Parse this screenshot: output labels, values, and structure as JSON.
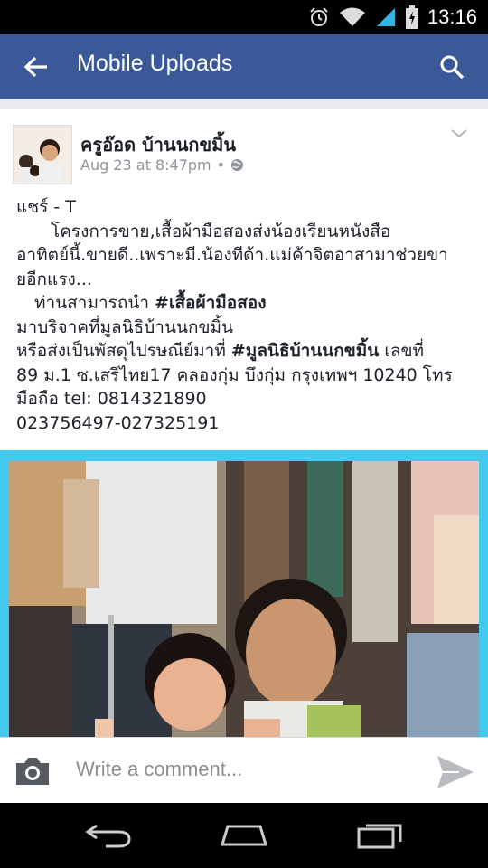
{
  "status_bar": {
    "time": "13:16",
    "icons": [
      "alarm-icon",
      "wifi-icon",
      "signal-icon",
      "battery-icon"
    ]
  },
  "app_bar": {
    "title": "Mobile Uploads",
    "color": "#3b5998",
    "icons": [
      "back-arrow-icon",
      "search-icon"
    ]
  },
  "post": {
    "author": "ครูอ๊อด บ้านนกขมิ้น",
    "timestamp": "Aug 23 at 8:47pm",
    "separator": "•",
    "privacy_icon": "globe-icon",
    "text_lines": {
      "l1": "แชร์ - T",
      "l2": "โครงการขาย,เสื้อผ้ามือสองส่งน้องเรียนหนังสือ",
      "l3": "อาทิตย์นี้.ขายดี..เพราะมี.น้องทีด้า.แม่ค้าจิตอาสามาช่วยขา",
      "l4": "ยอีกแรง...",
      "l5_a": "ท่านสามารถนำ ",
      "l5_b": "#เสื้อผ้ามือสอง",
      "l6": "มาบริจาคที่มูลนิธิบ้านนกขมิ้น",
      "l7_a": "หรือส่งเป็นพัสดุไปรษณีย์มาที่ ",
      "l7_b": "#มูลนิธิบ้านนกขมิ้น",
      "l7_c": " เลขที่",
      "l8": "89 ม.1 ซ.เสรีไทย17 คลองกุ่ม บึงกุ่ม กรุงเทพฯ 10240 โทร",
      "l9": "มือถือ tel: 0814321890",
      "l10": "023756497-027325191"
    },
    "photo_border_color": "#44c8ee"
  },
  "comment_bar": {
    "placeholder": "Write a comment...",
    "icons": [
      "camera-icon",
      "send-icon"
    ]
  },
  "nav_bar": {
    "icons": [
      "back-icon",
      "home-icon",
      "recents-icon"
    ]
  }
}
